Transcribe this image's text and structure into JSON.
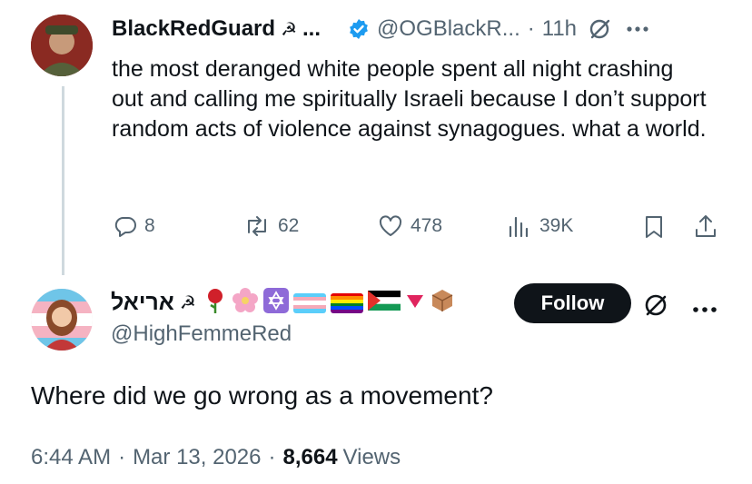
{
  "reply_to": {
    "display_name": "BlackRedGuard",
    "name_symbol": "☭",
    "name_ellipsis": "...",
    "handle": "@OGBlackR...",
    "separator": "·",
    "time": "11h",
    "text": "the most deranged white people spent all night crashing out and calling me spiritually Israeli because I don’t support random acts of violence against synagogues. what a world.",
    "actions": {
      "replies": "8",
      "reposts": "62",
      "likes": "478",
      "views": "39K"
    }
  },
  "main_post": {
    "display_name": "אריאל",
    "name_symbol": "☭",
    "handle": "@HighFemmeRed",
    "follow_label": "Follow",
    "text": "Where did we go wrong as a movement?",
    "time": "6:44 AM",
    "sep1": "·",
    "date": "Mar 13, 2026",
    "sep2": "·",
    "views_count": "8,664",
    "views_label": "Views"
  },
  "colors": {
    "verified": "#1d9bf0",
    "text": "#0f1419",
    "muted": "#536471",
    "follow_bg": "#0f1419"
  },
  "icons": [
    "grok-icon",
    "more-icon",
    "reply-icon",
    "repost-icon",
    "like-icon",
    "views-icon",
    "bookmark-icon",
    "share-icon",
    "verified-badge-icon"
  ]
}
